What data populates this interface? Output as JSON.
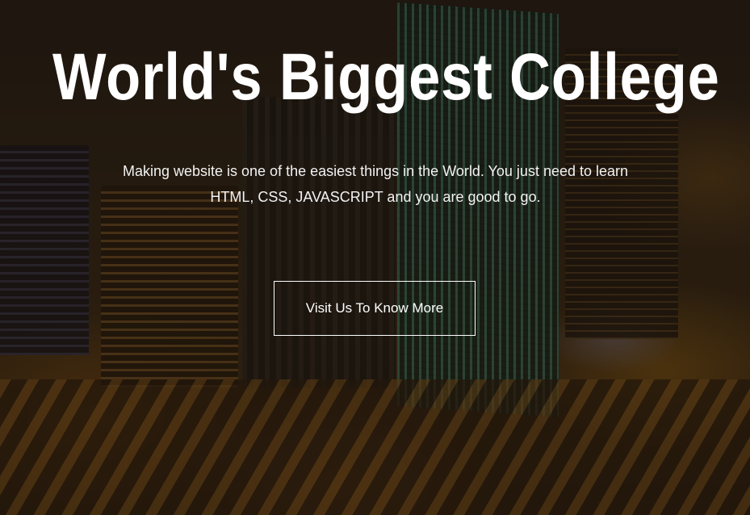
{
  "hero": {
    "title": "World's Biggest College",
    "subtitle": "Making website is one of the easiest things in the World. You just need to learn HTML, CSS, JAVASCRIPT and you are good to go.",
    "cta_label": "Visit Us To Know More"
  },
  "colors": {
    "text": "#ffffff",
    "overlay": "#140e0a",
    "background_accent": "#c8821e"
  }
}
